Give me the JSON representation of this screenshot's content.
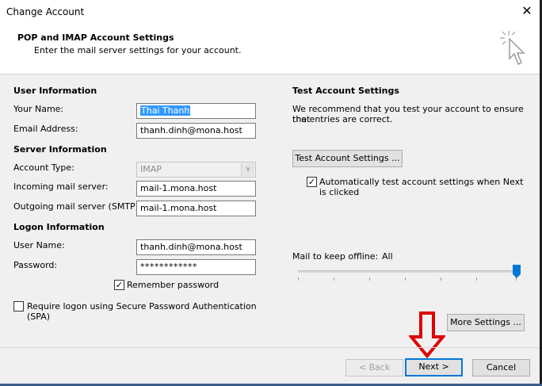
{
  "window": {
    "title": "Change Account",
    "close_glyph": "✕"
  },
  "header": {
    "title": "POP and IMAP Account Settings",
    "subtitle": "Enter the mail server settings for your account."
  },
  "user_info": {
    "heading": "User Information",
    "name_label": "Your Name:",
    "name_value": "Thai Thanh",
    "email_label": "Email Address:",
    "email_value": "thanh.dinh@mona.host"
  },
  "server_info": {
    "heading": "Server Information",
    "account_type_label": "Account Type:",
    "account_type_value": "IMAP",
    "incoming_label": "Incoming mail server:",
    "incoming_value": "mail-1.mona.host",
    "outgoing_label": "Outgoing mail server (SMTP):",
    "outgoing_value": "mail-1.mona.host"
  },
  "logon_info": {
    "heading": "Logon Information",
    "username_label": "User Name:",
    "username_value": "thanh.dinh@mona.host",
    "password_label": "Password:",
    "password_value": "************",
    "remember_label": "Remember password",
    "remember_checked": true,
    "spa_label_line1": "Require logon using Secure Password Authentication",
    "spa_label_line2": "(SPA)",
    "spa_checked": false
  },
  "test_settings": {
    "heading": "Test Account Settings",
    "desc_line1": "We recommend that you test your account to ensure that",
    "desc_line2": "the entries are correct.",
    "test_button": "Test Account Settings ...",
    "auto_test_line1": "Automatically test account settings when Next",
    "auto_test_line2": "is clicked",
    "auto_test_checked": true
  },
  "offline": {
    "label": "Mail to keep offline:",
    "value": "All",
    "slider_level": 1.0
  },
  "buttons": {
    "more_settings": "More Settings ...",
    "back": "< Back",
    "next": "Next >",
    "cancel": "Cancel"
  },
  "colors": {
    "accent": "#0078d7",
    "annotation_arrow": "#e00000",
    "selection": "#3399ff"
  },
  "icons": {
    "close": "close-icon",
    "wizard": "cursor-click-icon",
    "annotation": "red-down-arrow-icon"
  }
}
